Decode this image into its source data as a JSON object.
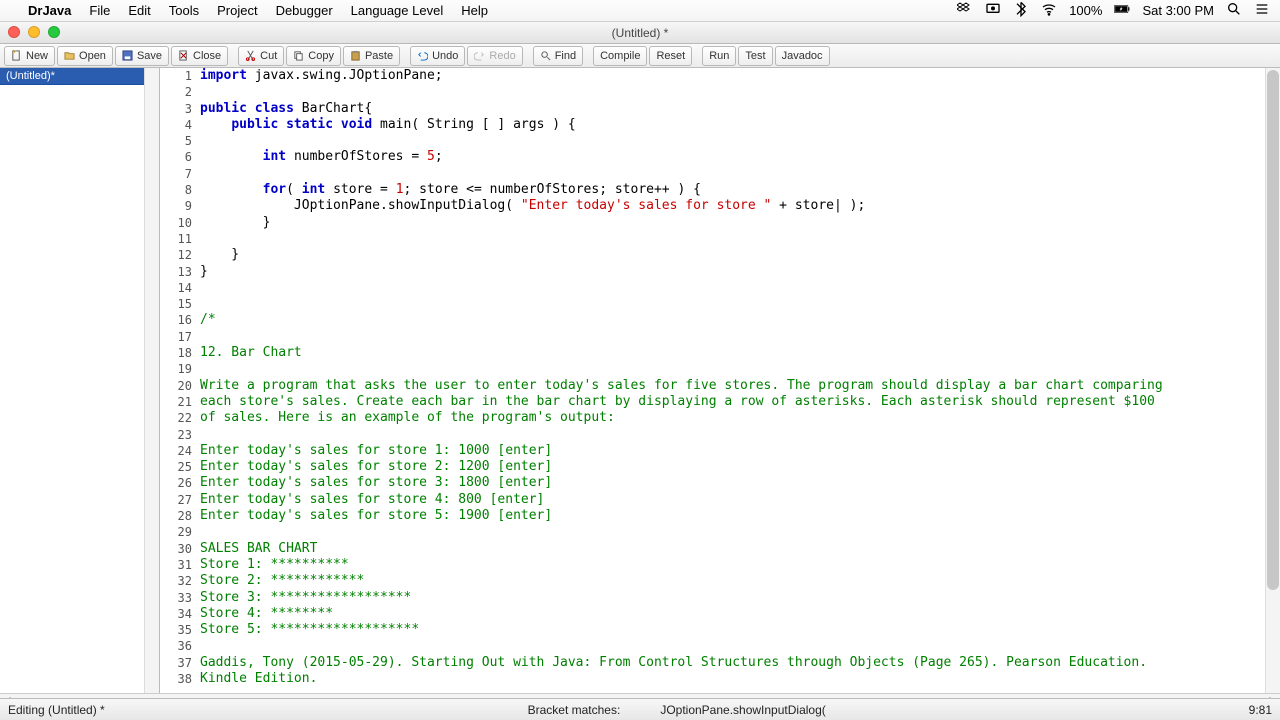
{
  "menubar": {
    "app": "DrJava",
    "items": [
      "File",
      "Edit",
      "Tools",
      "Project",
      "Debugger",
      "Language Level",
      "Help"
    ],
    "battery": "100%",
    "clock": "Sat 3:00 PM"
  },
  "window": {
    "title": "(Untitled) *"
  },
  "toolbar": {
    "new": "New",
    "open": "Open",
    "save": "Save",
    "close": "Close",
    "cut": "Cut",
    "copy": "Copy",
    "paste": "Paste",
    "undo": "Undo",
    "redo": "Redo",
    "find": "Find",
    "compile": "Compile",
    "reset": "Reset",
    "run": "Run",
    "test": "Test",
    "javadoc": "Javadoc"
  },
  "sidebar": {
    "file": "(Untitled)*"
  },
  "code": {
    "lines": [
      {
        "n": 1,
        "seg": [
          {
            "t": "import ",
            "c": "kw"
          },
          {
            "t": "javax.swing.JOptionPane;"
          }
        ]
      },
      {
        "n": 2,
        "seg": [
          {
            "t": ""
          }
        ]
      },
      {
        "n": 3,
        "seg": [
          {
            "t": "public class ",
            "c": "kw"
          },
          {
            "t": "BarChart{"
          }
        ]
      },
      {
        "n": 4,
        "seg": [
          {
            "t": "    "
          },
          {
            "t": "public static void ",
            "c": "kw"
          },
          {
            "t": "main( String [ ] args ) {"
          }
        ]
      },
      {
        "n": 5,
        "seg": [
          {
            "t": ""
          }
        ]
      },
      {
        "n": 6,
        "seg": [
          {
            "t": "        "
          },
          {
            "t": "int ",
            "c": "kw"
          },
          {
            "t": "numberOfStores = "
          },
          {
            "t": "5",
            "c": "num"
          },
          {
            "t": ";"
          }
        ]
      },
      {
        "n": 7,
        "seg": [
          {
            "t": ""
          }
        ]
      },
      {
        "n": 8,
        "seg": [
          {
            "t": "        "
          },
          {
            "t": "for",
            "c": "kw"
          },
          {
            "t": "( "
          },
          {
            "t": "int ",
            "c": "kw"
          },
          {
            "t": "store = "
          },
          {
            "t": "1",
            "c": "num"
          },
          {
            "t": "; store <= numberOfStores; store++ ) {"
          }
        ]
      },
      {
        "n": 9,
        "seg": [
          {
            "t": "            JOptionPane.showInputDialog( "
          },
          {
            "t": "\"Enter today's sales for store \"",
            "c": "str"
          },
          {
            "t": " + store| );"
          }
        ]
      },
      {
        "n": 10,
        "seg": [
          {
            "t": "        }"
          }
        ]
      },
      {
        "n": 11,
        "seg": [
          {
            "t": ""
          }
        ]
      },
      {
        "n": 12,
        "seg": [
          {
            "t": "    }"
          }
        ]
      },
      {
        "n": 13,
        "seg": [
          {
            "t": "}"
          }
        ]
      },
      {
        "n": 14,
        "seg": [
          {
            "t": ""
          }
        ]
      },
      {
        "n": 15,
        "seg": [
          {
            "t": ""
          }
        ]
      },
      {
        "n": 16,
        "seg": [
          {
            "t": "/*",
            "c": "cm"
          }
        ]
      },
      {
        "n": 17,
        "seg": [
          {
            "t": ""
          }
        ]
      },
      {
        "n": 18,
        "seg": [
          {
            "t": "12. Bar Chart",
            "c": "cm"
          }
        ]
      },
      {
        "n": 19,
        "seg": [
          {
            "t": ""
          }
        ]
      },
      {
        "n": 20,
        "seg": [
          {
            "t": "Write a program that asks the user to enter today's sales for five stores. The program should display a bar chart comparing",
            "c": "cm"
          }
        ]
      },
      {
        "n": 21,
        "seg": [
          {
            "t": "each store's sales. Create each bar in the bar chart by displaying a row of asterisks. Each asterisk should represent $100",
            "c": "cm"
          }
        ]
      },
      {
        "n": 22,
        "seg": [
          {
            "t": "of sales. Here is an example of the program's output:",
            "c": "cm"
          }
        ]
      },
      {
        "n": 23,
        "seg": [
          {
            "t": ""
          }
        ]
      },
      {
        "n": 24,
        "seg": [
          {
            "t": "Enter today's sales for store 1: 1000 [enter]",
            "c": "cm"
          }
        ]
      },
      {
        "n": 25,
        "seg": [
          {
            "t": "Enter today's sales for store 2: 1200 [enter]",
            "c": "cm"
          }
        ]
      },
      {
        "n": 26,
        "seg": [
          {
            "t": "Enter today's sales for store 3: 1800 [enter]",
            "c": "cm"
          }
        ]
      },
      {
        "n": 27,
        "seg": [
          {
            "t": "Enter today's sales for store 4: 800 [enter]",
            "c": "cm"
          }
        ]
      },
      {
        "n": 28,
        "seg": [
          {
            "t": "Enter today's sales for store 5: 1900 [enter]",
            "c": "cm"
          }
        ]
      },
      {
        "n": 29,
        "seg": [
          {
            "t": ""
          }
        ]
      },
      {
        "n": 30,
        "seg": [
          {
            "t": "SALES BAR CHART",
            "c": "cm"
          }
        ]
      },
      {
        "n": 31,
        "seg": [
          {
            "t": "Store 1: **********",
            "c": "cm"
          }
        ]
      },
      {
        "n": 32,
        "seg": [
          {
            "t": "Store 2: ************",
            "c": "cm"
          }
        ]
      },
      {
        "n": 33,
        "seg": [
          {
            "t": "Store 3: ******************",
            "c": "cm"
          }
        ]
      },
      {
        "n": 34,
        "seg": [
          {
            "t": "Store 4: ********",
            "c": "cm"
          }
        ]
      },
      {
        "n": 35,
        "seg": [
          {
            "t": "Store 5: *******************",
            "c": "cm"
          }
        ]
      },
      {
        "n": 36,
        "seg": [
          {
            "t": ""
          }
        ]
      },
      {
        "n": 37,
        "seg": [
          {
            "t": "Gaddis, Tony (2015-05-29). Starting Out with Java: From Control Structures through Objects (Page 265). Pearson Education.",
            "c": "cm"
          }
        ]
      },
      {
        "n": 38,
        "seg": [
          {
            "t": "Kindle Edition.",
            "c": "cm"
          }
        ]
      }
    ]
  },
  "status": {
    "left": "Editing (Untitled) *",
    "mid": "Bracket matches:",
    "file": "JOptionPane.showInputDialog(",
    "pos": "9:81"
  }
}
